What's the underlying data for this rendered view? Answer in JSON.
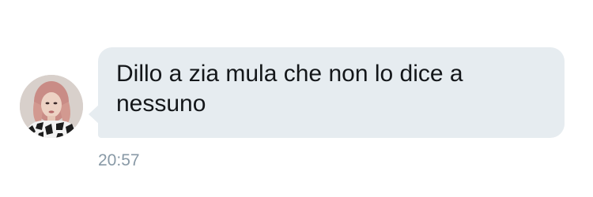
{
  "message": {
    "text": "Dillo a zia mula che non lo dice a nessuno",
    "timestamp": "20:57"
  },
  "sender": {
    "avatar_icon": "profile-photo"
  },
  "colors": {
    "bubble": "#e6ecf0",
    "text": "#14171a",
    "timestamp": "#8899a6",
    "background": "#ffffff"
  }
}
